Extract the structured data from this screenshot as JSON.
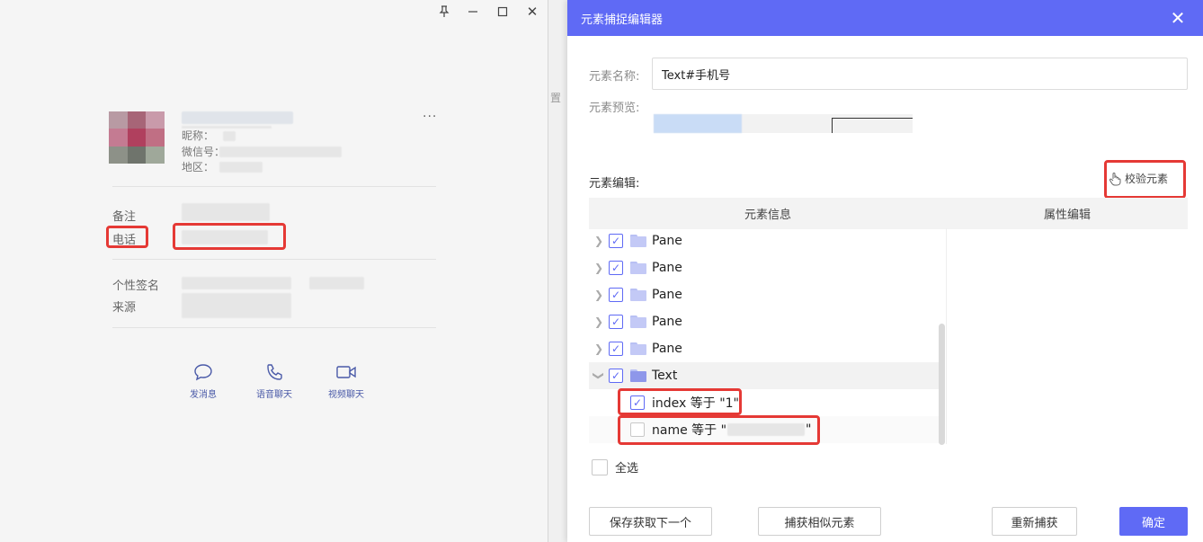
{
  "contact_window": {
    "controls": {
      "pin": "📌",
      "minimize": "—",
      "maximize": "☐",
      "close": "✕"
    },
    "profile": {
      "nickname_label": "昵称：",
      "wechat_id_label": "微信号：",
      "region_label": "地区："
    },
    "fields": {
      "remark_label": "备注",
      "phone_label": "电话",
      "signature_label": "个性签名",
      "source_label": "来源"
    },
    "actions": [
      {
        "label": "发消息",
        "icon": "chat-bubble-icon"
      },
      {
        "label": "语音聊天",
        "icon": "phone-icon"
      },
      {
        "label": "视频聊天",
        "icon": "video-camera-icon"
      }
    ]
  },
  "background_window": {
    "partial_text": "置"
  },
  "editor": {
    "title": "元素捕捉编辑器",
    "close_glyph": "✕",
    "name_label": "元素名称:",
    "name_value": "Text#手机号",
    "preview_label": "元素预览:",
    "section_title": "元素编辑:",
    "verify_button": "校验元素",
    "columns": {
      "info": "元素信息",
      "attributes": "属性编辑"
    },
    "tree": [
      {
        "label": "Pane",
        "checked": true,
        "expanded": false,
        "type": "folder"
      },
      {
        "label": "Pane",
        "checked": true,
        "expanded": false,
        "type": "folder"
      },
      {
        "label": "Pane",
        "checked": true,
        "expanded": false,
        "type": "folder"
      },
      {
        "label": "Pane",
        "checked": true,
        "expanded": false,
        "type": "folder"
      },
      {
        "label": "Pane",
        "checked": true,
        "expanded": false,
        "type": "folder"
      },
      {
        "label": "Text",
        "checked": true,
        "expanded": true,
        "type": "folder"
      },
      {
        "label": "index 等于 \"1\"",
        "checked": true,
        "type": "attribute"
      },
      {
        "label": "name 等于 \"",
        "label_end": "\"",
        "checked": false,
        "type": "attribute"
      }
    ],
    "select_all": "全选",
    "buttons": {
      "save_next": "保存获取下一个",
      "similar": "捕获相似元素",
      "recapture": "重新捕获",
      "ok": "确定"
    }
  },
  "colors": {
    "accent": "#5f6af5",
    "highlight_red": "#e53935"
  }
}
